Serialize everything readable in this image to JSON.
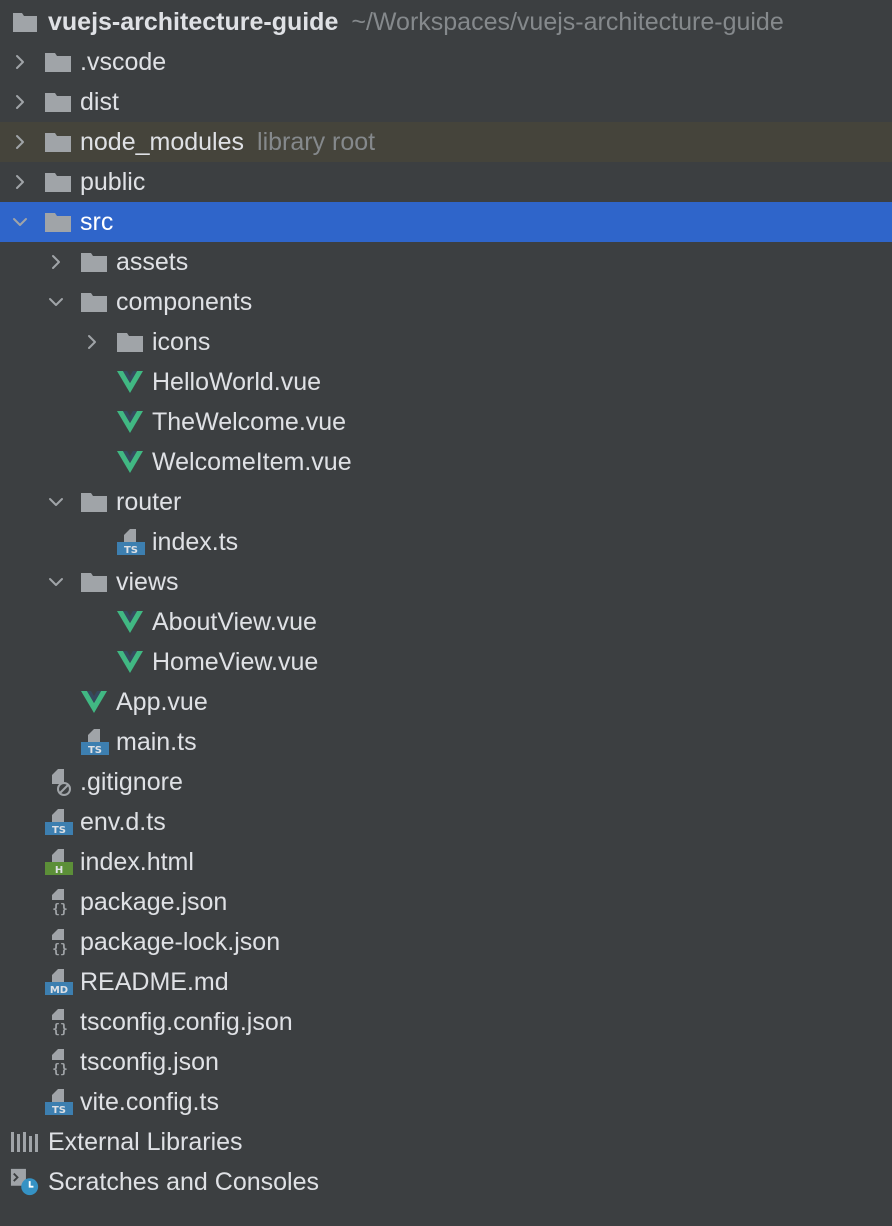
{
  "project": {
    "name": "vuejs-architecture-guide",
    "path": "~/Workspaces/vuejs-architecture-guide"
  },
  "items": [
    {
      "label": ".vscode",
      "hint": "",
      "type": "folder",
      "depth": 0,
      "expanded": false
    },
    {
      "label": "dist",
      "hint": "",
      "type": "folder",
      "depth": 0,
      "expanded": false
    },
    {
      "label": "node_modules",
      "hint": "library root",
      "type": "folder",
      "depth": 0,
      "expanded": false
    },
    {
      "label": "public",
      "hint": "",
      "type": "folder",
      "depth": 0,
      "expanded": false
    },
    {
      "label": "src",
      "hint": "",
      "type": "folder",
      "depth": 0,
      "expanded": true,
      "selected": true
    },
    {
      "label": "assets",
      "hint": "",
      "type": "folder",
      "depth": 1,
      "expanded": false
    },
    {
      "label": "components",
      "hint": "",
      "type": "folder",
      "depth": 1,
      "expanded": true
    },
    {
      "label": "icons",
      "hint": "",
      "type": "folder",
      "depth": 2,
      "expanded": false
    },
    {
      "label": "HelloWorld.vue",
      "hint": "",
      "type": "vue",
      "depth": 2
    },
    {
      "label": "TheWelcome.vue",
      "hint": "",
      "type": "vue",
      "depth": 2
    },
    {
      "label": "WelcomeItem.vue",
      "hint": "",
      "type": "vue",
      "depth": 2
    },
    {
      "label": "router",
      "hint": "",
      "type": "folder",
      "depth": 1,
      "expanded": true
    },
    {
      "label": "index.ts",
      "hint": "",
      "type": "ts",
      "depth": 2
    },
    {
      "label": "views",
      "hint": "",
      "type": "folder",
      "depth": 1,
      "expanded": true
    },
    {
      "label": "AboutView.vue",
      "hint": "",
      "type": "vue",
      "depth": 2
    },
    {
      "label": "HomeView.vue",
      "hint": "",
      "type": "vue",
      "depth": 2
    },
    {
      "label": "App.vue",
      "hint": "",
      "type": "vue",
      "depth": 1
    },
    {
      "label": "main.ts",
      "hint": "",
      "type": "ts",
      "depth": 1
    },
    {
      "label": ".gitignore",
      "hint": "",
      "type": "ignore",
      "depth": 0
    },
    {
      "label": "env.d.ts",
      "hint": "",
      "type": "ts",
      "depth": 0
    },
    {
      "label": "index.html",
      "hint": "",
      "type": "html",
      "depth": 0
    },
    {
      "label": "package.json",
      "hint": "",
      "type": "json",
      "depth": 0
    },
    {
      "label": "package-lock.json",
      "hint": "",
      "type": "json",
      "depth": 0
    },
    {
      "label": "README.md",
      "hint": "",
      "type": "md",
      "depth": 0
    },
    {
      "label": "tsconfig.config.json",
      "hint": "",
      "type": "json",
      "depth": 0
    },
    {
      "label": "tsconfig.json",
      "hint": "",
      "type": "json",
      "depth": 0
    },
    {
      "label": "vite.config.ts",
      "hint": "",
      "type": "ts",
      "depth": 0
    }
  ],
  "external_libraries": "External Libraries",
  "scratches": "Scratches and Consoles",
  "colors": {
    "background": "#3c3f41",
    "selection": "#2f65ca",
    "library_row": "#45443b",
    "folder_icon": "#a0a4a8",
    "vue_icon": "#41b883",
    "ts_badge": "#3d7fb0",
    "html_badge": "#5c8f38"
  }
}
